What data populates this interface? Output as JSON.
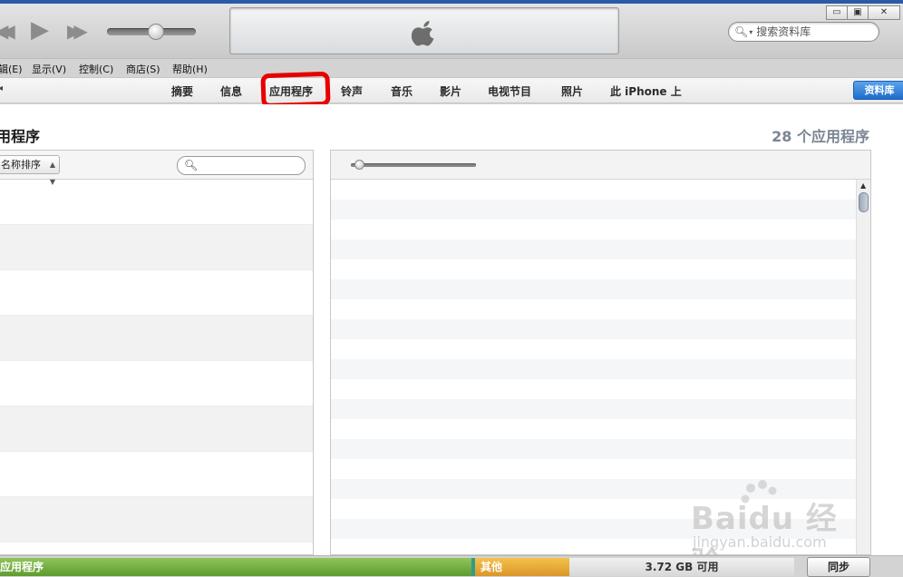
{
  "menu": [
    "辑(E)",
    "显示(V)",
    "控制(C)",
    "商店(S)",
    "帮助(H)"
  ],
  "toolbar": {
    "search_placeholder": "搜索资料库",
    "win_minimize": "▭",
    "win_restore": "▣",
    "win_close": "✕"
  },
  "nav": {
    "left_arrow": "◂",
    "tabs": [
      "摘要",
      "信息",
      "应用程序",
      "铃声",
      "音乐",
      "影片",
      "电视节目",
      "照片",
      "此 iPhone 上"
    ],
    "library_button": "资料库"
  },
  "content": {
    "section_title": "用程序",
    "app_count": "28 个应用程序",
    "sort_label": "名称排序"
  },
  "storage": {
    "apps_label": "应用程序",
    "other_label": "其他",
    "free_label": "3.72 GB 可用",
    "sync_button": "同步"
  },
  "watermark": {
    "brand": "Baidu 经验",
    "url": "jingyan.baidu.com"
  },
  "colors": {
    "accent_blue": "#1f6dc9",
    "apps_green": "#6ea93a",
    "other_orange": "#e6a836",
    "highlight_red": "#e60000"
  }
}
